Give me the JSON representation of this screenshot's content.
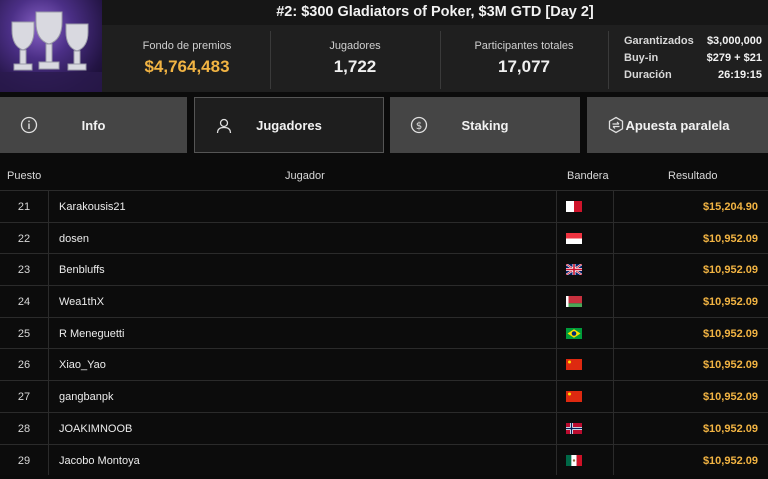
{
  "title": "#2: $300 Gladiators of Poker, $3M GTD [Day 2]",
  "stats": {
    "prize_label": "Fondo de premios",
    "prize_value": "$4,764,483",
    "players_label": "Jugadores",
    "players_value": "1,722",
    "entrants_label": "Participantes totales",
    "entrants_value": "17,077"
  },
  "details": [
    {
      "label": "Garantizados",
      "value": "$3,000,000"
    },
    {
      "label": "Buy-in",
      "value": "$279 + $21"
    },
    {
      "label": "Duración",
      "value": "26:19:15"
    }
  ],
  "tabs": [
    {
      "label": "Info",
      "icon": "info-icon"
    },
    {
      "label": "Jugadores",
      "icon": "person-icon"
    },
    {
      "label": "Staking",
      "icon": "dollar-icon"
    },
    {
      "label": "Apuesta paralela",
      "icon": "swap-icon"
    }
  ],
  "table": {
    "headers": {
      "pos": "Puesto",
      "player": "Jugador",
      "flag": "Bandera",
      "result": "Resultado"
    },
    "rows": [
      {
        "pos": "21",
        "name": "Karakousis21",
        "flag": "malta",
        "result": "$15,204.90"
      },
      {
        "pos": "22",
        "name": "dosen",
        "flag": "singapore",
        "result": "$10,952.09"
      },
      {
        "pos": "23",
        "name": "Benbluffs",
        "flag": "united-kingdom",
        "result": "$10,952.09"
      },
      {
        "pos": "24",
        "name": "Wea1thX",
        "flag": "belarus",
        "result": "$10,952.09"
      },
      {
        "pos": "25",
        "name": "R Meneguetti",
        "flag": "brazil",
        "result": "$10,952.09"
      },
      {
        "pos": "26",
        "name": "Xiao_Yao",
        "flag": "china",
        "result": "$10,952.09"
      },
      {
        "pos": "27",
        "name": "gangbanpk",
        "flag": "china",
        "result": "$10,952.09"
      },
      {
        "pos": "28",
        "name": "JOAKIMNOOB",
        "flag": "norway",
        "result": "$10,952.09"
      },
      {
        "pos": "29",
        "name": "Jacobo Montoya",
        "flag": "mexico",
        "result": "$10,952.09"
      }
    ]
  },
  "colors": {
    "accent": "#f2b443",
    "tab_bg": "#454545",
    "active_tab_bg": "#1e1e1e"
  }
}
